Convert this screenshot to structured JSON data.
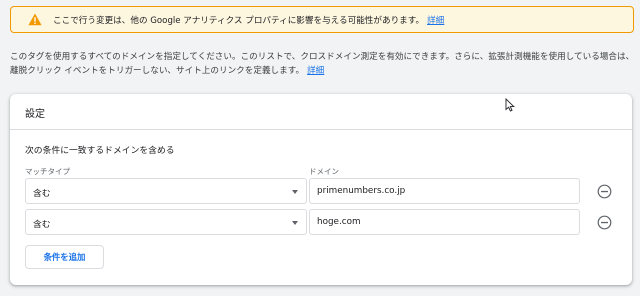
{
  "warning": {
    "text": "ここで行う変更は、他の Google アナリティクス プロパティに影響を与える可能性があります。",
    "link": "詳細",
    "icon": "warning-triangle-icon",
    "accent_color": "#f29900"
  },
  "description": {
    "text": "このタグを使用するすべてのドメインを指定してください。このリストで、クロスドメイン測定を有効にできます。さらに、拡張計測機能を使用している場合は、離脱クリック イベントをトリガーしない、サイト上のリンクを定義します。",
    "link": "詳細"
  },
  "settings": {
    "title": "設定",
    "condition_label": "次の条件に一致するドメインを含める",
    "match_type_label": "マッチタイプ",
    "domain_label": "ドメイン",
    "rows": [
      {
        "match_type": "含む",
        "domain": "primenumbers.co.jp"
      },
      {
        "match_type": "含む",
        "domain": "hoge.com"
      }
    ],
    "add_button": "条件を追加"
  },
  "colors": {
    "link": "#1a73e8",
    "background": "#f1f3f4",
    "warning_bg": "#fef7e0"
  }
}
